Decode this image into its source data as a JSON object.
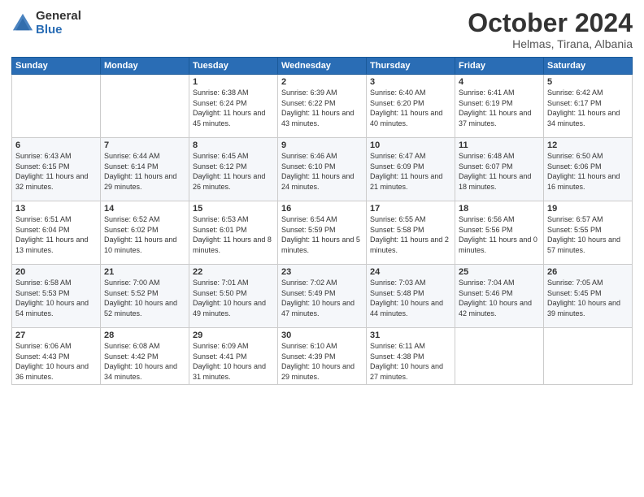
{
  "header": {
    "logo_general": "General",
    "logo_blue": "Blue",
    "month_title": "October 2024",
    "location": "Helmas, Tirana, Albania"
  },
  "weekdays": [
    "Sunday",
    "Monday",
    "Tuesday",
    "Wednesday",
    "Thursday",
    "Friday",
    "Saturday"
  ],
  "weeks": [
    [
      {
        "day": "",
        "sunrise": "",
        "sunset": "",
        "daylight": ""
      },
      {
        "day": "",
        "sunrise": "",
        "sunset": "",
        "daylight": ""
      },
      {
        "day": "1",
        "sunrise": "Sunrise: 6:38 AM",
        "sunset": "Sunset: 6:24 PM",
        "daylight": "Daylight: 11 hours and 45 minutes."
      },
      {
        "day": "2",
        "sunrise": "Sunrise: 6:39 AM",
        "sunset": "Sunset: 6:22 PM",
        "daylight": "Daylight: 11 hours and 43 minutes."
      },
      {
        "day": "3",
        "sunrise": "Sunrise: 6:40 AM",
        "sunset": "Sunset: 6:20 PM",
        "daylight": "Daylight: 11 hours and 40 minutes."
      },
      {
        "day": "4",
        "sunrise": "Sunrise: 6:41 AM",
        "sunset": "Sunset: 6:19 PM",
        "daylight": "Daylight: 11 hours and 37 minutes."
      },
      {
        "day": "5",
        "sunrise": "Sunrise: 6:42 AM",
        "sunset": "Sunset: 6:17 PM",
        "daylight": "Daylight: 11 hours and 34 minutes."
      }
    ],
    [
      {
        "day": "6",
        "sunrise": "Sunrise: 6:43 AM",
        "sunset": "Sunset: 6:15 PM",
        "daylight": "Daylight: 11 hours and 32 minutes."
      },
      {
        "day": "7",
        "sunrise": "Sunrise: 6:44 AM",
        "sunset": "Sunset: 6:14 PM",
        "daylight": "Daylight: 11 hours and 29 minutes."
      },
      {
        "day": "8",
        "sunrise": "Sunrise: 6:45 AM",
        "sunset": "Sunset: 6:12 PM",
        "daylight": "Daylight: 11 hours and 26 minutes."
      },
      {
        "day": "9",
        "sunrise": "Sunrise: 6:46 AM",
        "sunset": "Sunset: 6:10 PM",
        "daylight": "Daylight: 11 hours and 24 minutes."
      },
      {
        "day": "10",
        "sunrise": "Sunrise: 6:47 AM",
        "sunset": "Sunset: 6:09 PM",
        "daylight": "Daylight: 11 hours and 21 minutes."
      },
      {
        "day": "11",
        "sunrise": "Sunrise: 6:48 AM",
        "sunset": "Sunset: 6:07 PM",
        "daylight": "Daylight: 11 hours and 18 minutes."
      },
      {
        "day": "12",
        "sunrise": "Sunrise: 6:50 AM",
        "sunset": "Sunset: 6:06 PM",
        "daylight": "Daylight: 11 hours and 16 minutes."
      }
    ],
    [
      {
        "day": "13",
        "sunrise": "Sunrise: 6:51 AM",
        "sunset": "Sunset: 6:04 PM",
        "daylight": "Daylight: 11 hours and 13 minutes."
      },
      {
        "day": "14",
        "sunrise": "Sunrise: 6:52 AM",
        "sunset": "Sunset: 6:02 PM",
        "daylight": "Daylight: 11 hours and 10 minutes."
      },
      {
        "day": "15",
        "sunrise": "Sunrise: 6:53 AM",
        "sunset": "Sunset: 6:01 PM",
        "daylight": "Daylight: 11 hours and 8 minutes."
      },
      {
        "day": "16",
        "sunrise": "Sunrise: 6:54 AM",
        "sunset": "Sunset: 5:59 PM",
        "daylight": "Daylight: 11 hours and 5 minutes."
      },
      {
        "day": "17",
        "sunrise": "Sunrise: 6:55 AM",
        "sunset": "Sunset: 5:58 PM",
        "daylight": "Daylight: 11 hours and 2 minutes."
      },
      {
        "day": "18",
        "sunrise": "Sunrise: 6:56 AM",
        "sunset": "Sunset: 5:56 PM",
        "daylight": "Daylight: 11 hours and 0 minutes."
      },
      {
        "day": "19",
        "sunrise": "Sunrise: 6:57 AM",
        "sunset": "Sunset: 5:55 PM",
        "daylight": "Daylight: 10 hours and 57 minutes."
      }
    ],
    [
      {
        "day": "20",
        "sunrise": "Sunrise: 6:58 AM",
        "sunset": "Sunset: 5:53 PM",
        "daylight": "Daylight: 10 hours and 54 minutes."
      },
      {
        "day": "21",
        "sunrise": "Sunrise: 7:00 AM",
        "sunset": "Sunset: 5:52 PM",
        "daylight": "Daylight: 10 hours and 52 minutes."
      },
      {
        "day": "22",
        "sunrise": "Sunrise: 7:01 AM",
        "sunset": "Sunset: 5:50 PM",
        "daylight": "Daylight: 10 hours and 49 minutes."
      },
      {
        "day": "23",
        "sunrise": "Sunrise: 7:02 AM",
        "sunset": "Sunset: 5:49 PM",
        "daylight": "Daylight: 10 hours and 47 minutes."
      },
      {
        "day": "24",
        "sunrise": "Sunrise: 7:03 AM",
        "sunset": "Sunset: 5:48 PM",
        "daylight": "Daylight: 10 hours and 44 minutes."
      },
      {
        "day": "25",
        "sunrise": "Sunrise: 7:04 AM",
        "sunset": "Sunset: 5:46 PM",
        "daylight": "Daylight: 10 hours and 42 minutes."
      },
      {
        "day": "26",
        "sunrise": "Sunrise: 7:05 AM",
        "sunset": "Sunset: 5:45 PM",
        "daylight": "Daylight: 10 hours and 39 minutes."
      }
    ],
    [
      {
        "day": "27",
        "sunrise": "Sunrise: 6:06 AM",
        "sunset": "Sunset: 4:43 PM",
        "daylight": "Daylight: 10 hours and 36 minutes."
      },
      {
        "day": "28",
        "sunrise": "Sunrise: 6:08 AM",
        "sunset": "Sunset: 4:42 PM",
        "daylight": "Daylight: 10 hours and 34 minutes."
      },
      {
        "day": "29",
        "sunrise": "Sunrise: 6:09 AM",
        "sunset": "Sunset: 4:41 PM",
        "daylight": "Daylight: 10 hours and 31 minutes."
      },
      {
        "day": "30",
        "sunrise": "Sunrise: 6:10 AM",
        "sunset": "Sunset: 4:39 PM",
        "daylight": "Daylight: 10 hours and 29 minutes."
      },
      {
        "day": "31",
        "sunrise": "Sunrise: 6:11 AM",
        "sunset": "Sunset: 4:38 PM",
        "daylight": "Daylight: 10 hours and 27 minutes."
      },
      {
        "day": "",
        "sunrise": "",
        "sunset": "",
        "daylight": ""
      },
      {
        "day": "",
        "sunrise": "",
        "sunset": "",
        "daylight": ""
      }
    ]
  ]
}
